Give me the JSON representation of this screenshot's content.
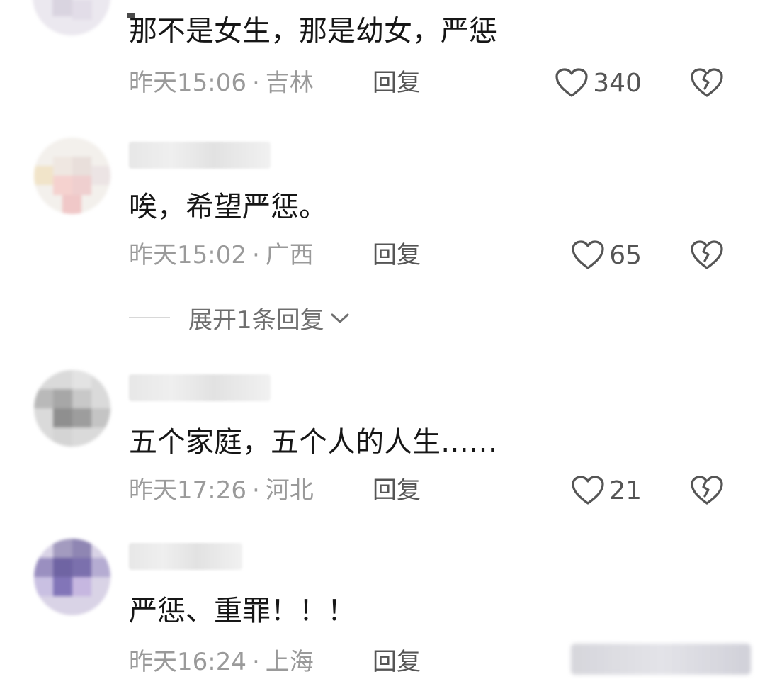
{
  "comments": [
    {
      "content": "那不是女生，那是幼女，严惩",
      "time": "昨天15:06",
      "location": "吉林",
      "reply_label": "回复",
      "likes": "340"
    },
    {
      "content": "唉，希望严惩。",
      "time": "昨天15:02",
      "location": "广西",
      "reply_label": "回复",
      "likes": "65",
      "expand_label": "展开1条回复"
    },
    {
      "content": "五个家庭，五个人的人生……",
      "time": "昨天17:26",
      "location": "河北",
      "reply_label": "回复",
      "likes": "21"
    },
    {
      "content": "严惩、重罪！！！",
      "time": "昨天16:24",
      "location": "上海",
      "reply_label": "回复"
    }
  ],
  "separator": "·",
  "icons": {
    "like": "heart-outline-icon",
    "dislike": "broken-heart-icon",
    "expand": "chevron-down-icon"
  },
  "colors": {
    "text_primary": "#161616",
    "text_meta": "#9a9a9a",
    "icon_gray": "#555555",
    "background": "#ffffff"
  }
}
